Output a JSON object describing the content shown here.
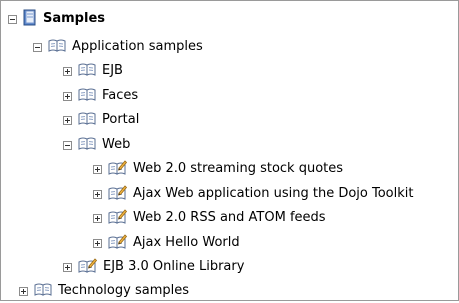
{
  "tree": {
    "root": {
      "label": "Samples",
      "icon": "samples-book-icon",
      "state": "expanded"
    },
    "items": [
      {
        "label": "Application samples",
        "icon": "book-icon",
        "state": "expanded"
      },
      {
        "label": "EJB",
        "icon": "book-icon",
        "state": "collapsed"
      },
      {
        "label": "Faces",
        "icon": "book-icon",
        "state": "collapsed"
      },
      {
        "label": "Portal",
        "icon": "book-icon",
        "state": "collapsed"
      },
      {
        "label": "Web",
        "icon": "book-icon",
        "state": "expanded"
      },
      {
        "label": "Web 2.0 streaming stock quotes",
        "icon": "book-edit-icon",
        "state": "collapsed"
      },
      {
        "label": "Ajax Web application using the Dojo Toolkit",
        "icon": "book-edit-icon",
        "state": "collapsed"
      },
      {
        "label": "Web 2.0 RSS and ATOM feeds",
        "icon": "book-edit-icon",
        "state": "collapsed"
      },
      {
        "label": "Ajax Hello World",
        "icon": "book-edit-icon",
        "state": "collapsed"
      },
      {
        "label": "EJB 3.0 Online Library",
        "icon": "book-edit-icon",
        "state": "collapsed"
      },
      {
        "label": "Technology samples",
        "icon": "book-icon",
        "state": "collapsed"
      }
    ]
  }
}
